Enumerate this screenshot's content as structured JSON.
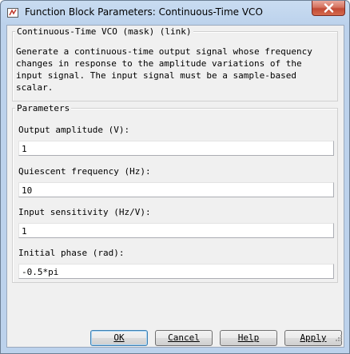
{
  "window": {
    "title": "Function Block Parameters: Continuous-Time VCO"
  },
  "mask": {
    "title": "Continuous-Time VCO (mask) (link)",
    "description": "Generate a continuous-time output signal whose frequency\nchanges in response to the amplitude variations of the\ninput signal. The input signal must be a sample-based\nscalar."
  },
  "parameters": {
    "title": "Parameters",
    "fields": [
      {
        "label": "Output amplitude (V):",
        "value": "1"
      },
      {
        "label": "Quiescent frequency (Hz):",
        "value": "10"
      },
      {
        "label": "Input sensitivity (Hz/V):",
        "value": "1"
      },
      {
        "label": "Initial phase (rad):",
        "value": "-0.5*pi"
      }
    ]
  },
  "buttons": {
    "ok": "OK",
    "cancel": "Cancel",
    "help": "Help",
    "apply": "Apply"
  },
  "icons": {
    "app": "simulink-block-icon",
    "close": "close-icon",
    "resize": "resize-grip-icon"
  }
}
